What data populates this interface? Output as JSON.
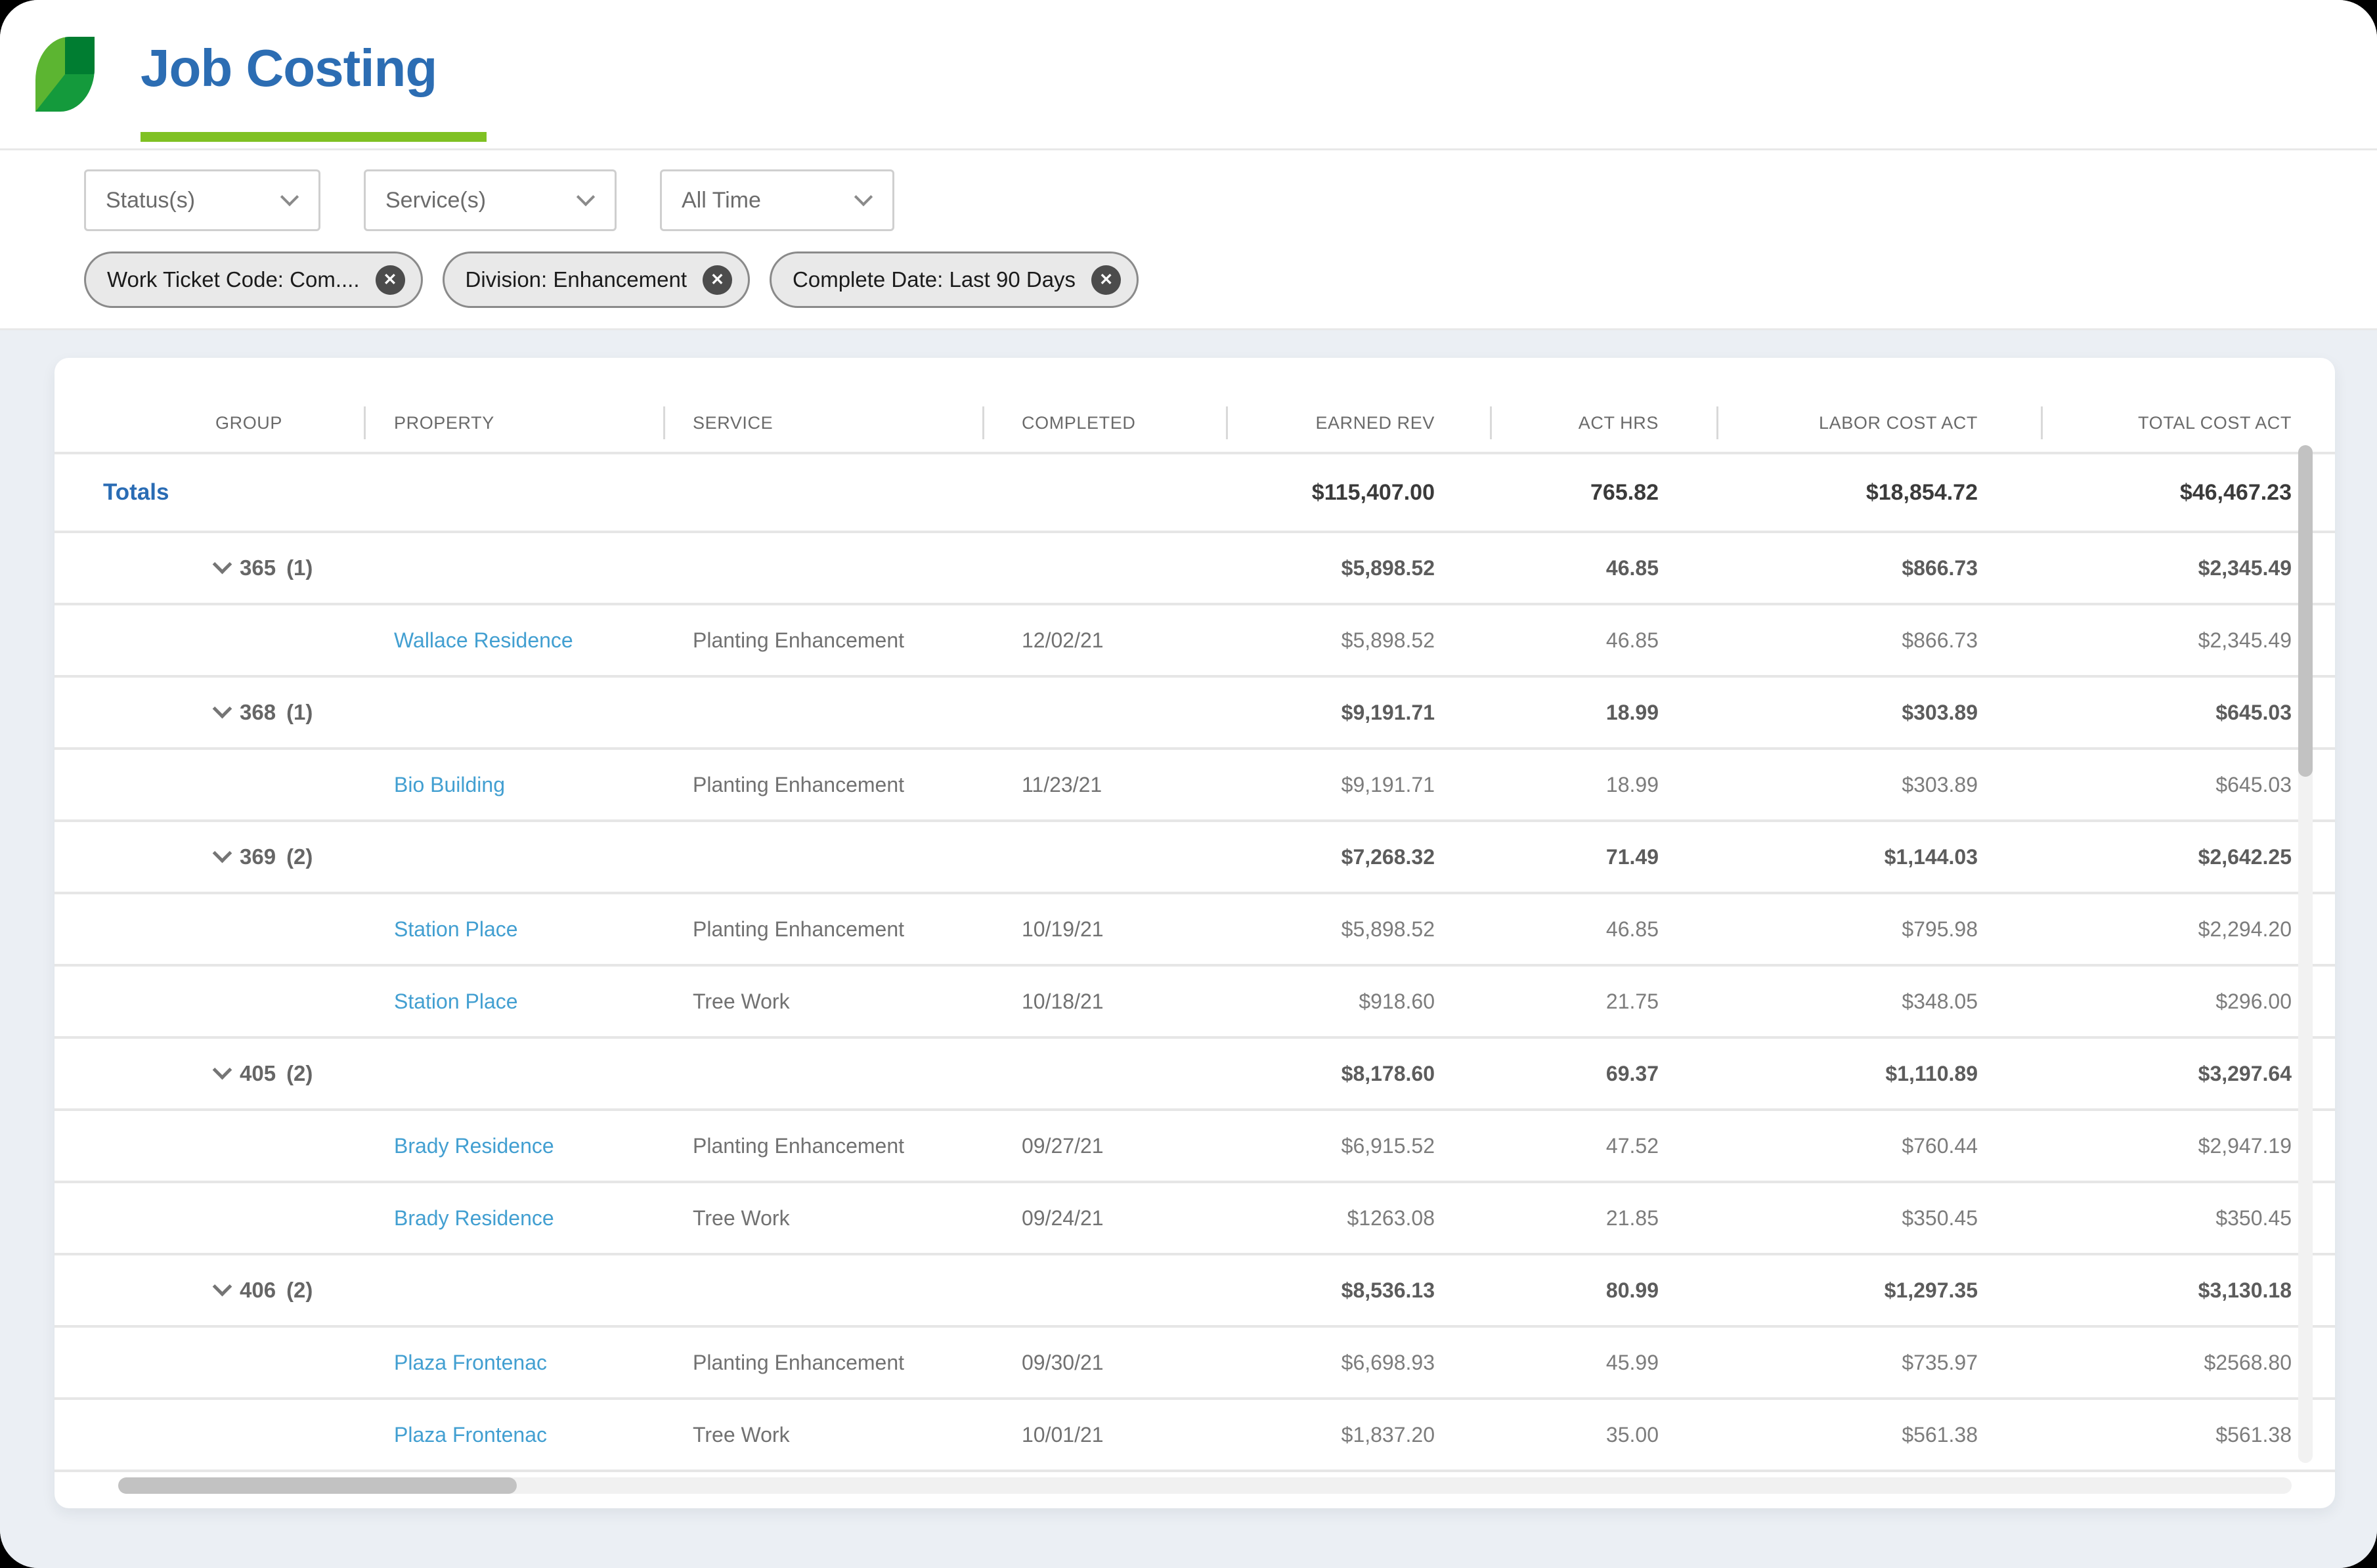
{
  "header": {
    "title": "Job Costing"
  },
  "icons": {
    "close": "✕"
  },
  "colors": {
    "brand_green_light": "#5cb531",
    "brand_green_mid": "#149a3c",
    "brand_green_dark": "#007d31",
    "title_blue": "#2c6db3",
    "underline_green": "#7fc123",
    "link_blue": "#429fd1",
    "totals_blue": "#2a6cb4"
  },
  "filters": {
    "dropdowns": [
      {
        "label": "Status(s)"
      },
      {
        "label": "Service(s)"
      },
      {
        "label": "All Time"
      }
    ],
    "chips": [
      {
        "label": "Work Ticket Code: Com...."
      },
      {
        "label": "Division: Enhancement"
      },
      {
        "label": "Complete Date: Last 90 Days"
      }
    ]
  },
  "table": {
    "columns": [
      "GROUP",
      "PROPERTY",
      "SERVICE",
      "COMPLETED",
      "EARNED REV",
      "ACT HRS",
      "LABOR COST ACT",
      "TOTAL COST ACT"
    ],
    "totals": {
      "label": "Totals",
      "earned_rev": "$115,407.00",
      "act_hrs": "765.82",
      "labor_cost_act": "$18,854.72",
      "total_cost_act": "$46,467.23"
    },
    "groups": [
      {
        "label": "365",
        "count": "(1)",
        "earned_rev": "$5,898.52",
        "act_hrs": "46.85",
        "labor_cost_act": "$866.73",
        "total_cost_act": "$2,345.49",
        "rows": [
          {
            "property": "Wallace Residence",
            "service": "Planting Enhancement",
            "completed": "12/02/21",
            "earned_rev": "$5,898.52",
            "act_hrs": "46.85",
            "labor_cost_act": "$866.73",
            "total_cost_act": "$2,345.49"
          }
        ]
      },
      {
        "label": "368",
        "count": "(1)",
        "earned_rev": "$9,191.71",
        "act_hrs": "18.99",
        "labor_cost_act": "$303.89",
        "total_cost_act": "$645.03",
        "rows": [
          {
            "property": "Bio Building",
            "service": "Planting Enhancement",
            "completed": "11/23/21",
            "earned_rev": "$9,191.71",
            "act_hrs": "18.99",
            "labor_cost_act": "$303.89",
            "total_cost_act": "$645.03"
          }
        ]
      },
      {
        "label": "369",
        "count": "(2)",
        "earned_rev": "$7,268.32",
        "act_hrs": "71.49",
        "labor_cost_act": "$1,144.03",
        "total_cost_act": "$2,642.25",
        "rows": [
          {
            "property": "Station Place",
            "service": "Planting Enhancement",
            "completed": "10/19/21",
            "earned_rev": "$5,898.52",
            "act_hrs": "46.85",
            "labor_cost_act": "$795.98",
            "total_cost_act": "$2,294.20"
          },
          {
            "property": "Station Place",
            "service": "Tree Work",
            "completed": "10/18/21",
            "earned_rev": "$918.60",
            "act_hrs": "21.75",
            "labor_cost_act": "$348.05",
            "total_cost_act": "$296.00"
          }
        ]
      },
      {
        "label": "405",
        "count": "(2)",
        "earned_rev": "$8,178.60",
        "act_hrs": "69.37",
        "labor_cost_act": "$1,110.89",
        "total_cost_act": "$3,297.64",
        "rows": [
          {
            "property": "Brady Residence",
            "service": "Planting Enhancement",
            "completed": "09/27/21",
            "earned_rev": "$6,915.52",
            "act_hrs": "47.52",
            "labor_cost_act": "$760.44",
            "total_cost_act": "$2,947.19"
          },
          {
            "property": "Brady Residence",
            "service": "Tree Work",
            "completed": "09/24/21",
            "earned_rev": "$1263.08",
            "act_hrs": "21.85",
            "labor_cost_act": "$350.45",
            "total_cost_act": "$350.45"
          }
        ]
      },
      {
        "label": "406",
        "count": "(2)",
        "earned_rev": "$8,536.13",
        "act_hrs": "80.99",
        "labor_cost_act": "$1,297.35",
        "total_cost_act": "$3,130.18",
        "rows": [
          {
            "property": "Plaza Frontenac",
            "service": "Planting Enhancement",
            "completed": "09/30/21",
            "earned_rev": "$6,698.93",
            "act_hrs": "45.99",
            "labor_cost_act": "$735.97",
            "total_cost_act": "$2568.80"
          },
          {
            "property": "Plaza Frontenac",
            "service": "Tree Work",
            "completed": "10/01/21",
            "earned_rev": "$1,837.20",
            "act_hrs": "35.00",
            "labor_cost_act": "$561.38",
            "total_cost_act": "$561.38"
          }
        ]
      }
    ]
  }
}
